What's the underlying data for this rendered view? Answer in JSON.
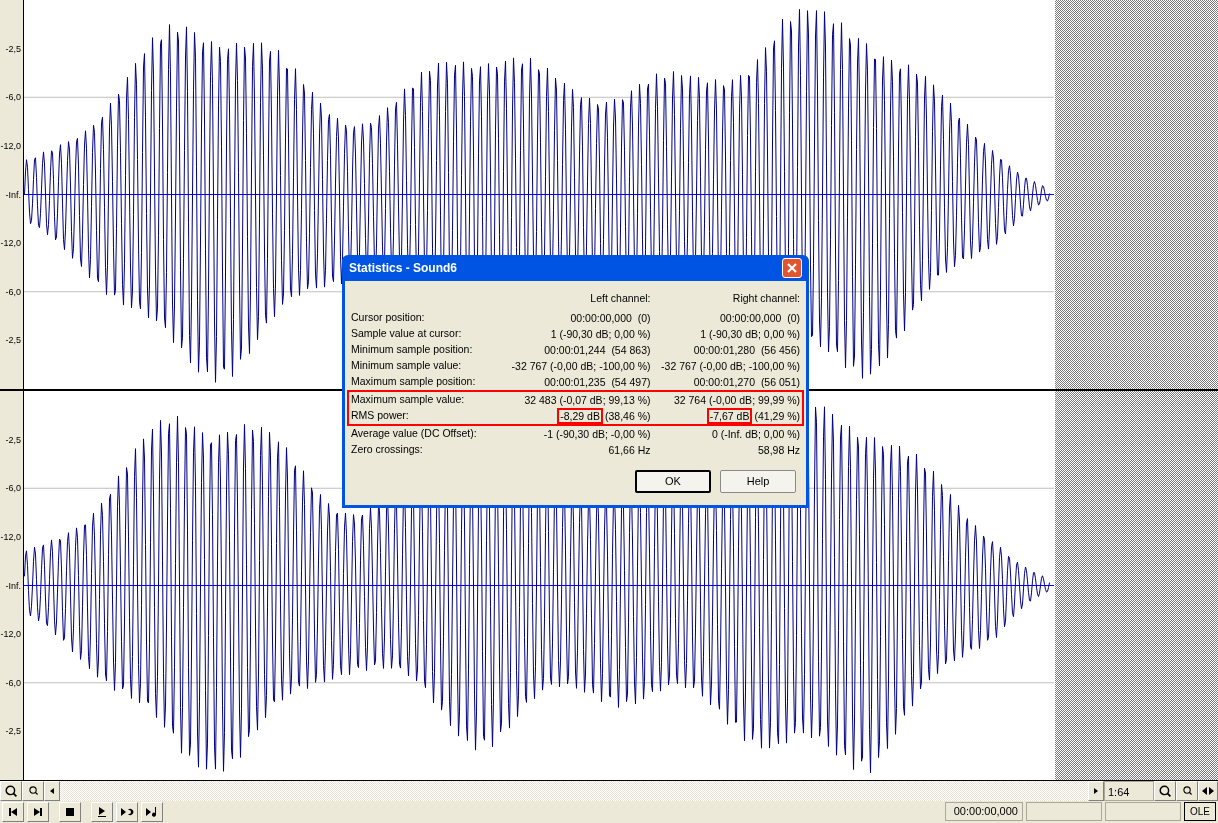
{
  "channels": [
    {
      "axis_labels": [
        "-2,5",
        "-6,0",
        "-12,0",
        "-Inf.",
        "-12,0",
        "-6,0",
        "-2,5"
      ]
    },
    {
      "axis_labels": [
        "-2,5",
        "-6,0",
        "-12,0",
        "-Inf.",
        "-12,0",
        "-6,0",
        "-2,5"
      ]
    }
  ],
  "dialog": {
    "title": "Statistics - Sound6",
    "columns": [
      "Left channel:",
      "Right channel:"
    ],
    "rows": [
      {
        "label": "Cursor position:",
        "highlighted": false,
        "left": [
          {
            "text": "00:00:00,000  (0)",
            "boxed": false
          }
        ],
        "right": [
          {
            "text": "00:00:00,000  (0)",
            "boxed": false
          }
        ]
      },
      {
        "label": "Sample value at cursor:",
        "highlighted": false,
        "left": [
          {
            "text": "1 (-90,30 dB; 0,00 %)",
            "boxed": false
          }
        ],
        "right": [
          {
            "text": "1 (-90,30 dB; 0,00 %)",
            "boxed": false
          }
        ]
      },
      {
        "label": "Minimum sample position:",
        "highlighted": false,
        "left": [
          {
            "text": "00:00:01,244  (54 863)",
            "boxed": false
          }
        ],
        "right": [
          {
            "text": "00:00:01,280  (56 456)",
            "boxed": false
          }
        ]
      },
      {
        "label": "Minimum sample value:",
        "highlighted": false,
        "left": [
          {
            "text": "-32 767 (-0,00 dB; -100,00 %)",
            "boxed": false
          }
        ],
        "right": [
          {
            "text": "-32 767 (-0,00 dB; -100,00 %)",
            "boxed": false
          }
        ]
      },
      {
        "label": "Maximum sample position:",
        "highlighted": false,
        "left": [
          {
            "text": "00:00:01,235  (54 497)",
            "boxed": false
          }
        ],
        "right": [
          {
            "text": "00:00:01,270  (56 051)",
            "boxed": false
          }
        ]
      },
      {
        "label": "Maximum sample value:",
        "highlighted": true,
        "left": [
          {
            "text": "32 483 (-0,07 dB; 99,13 %)",
            "boxed": false
          }
        ],
        "right": [
          {
            "text": "32 764 (-0,00 dB; 99,99 %)",
            "boxed": false
          }
        ]
      },
      {
        "label": "RMS power:",
        "highlighted": true,
        "left": [
          {
            "text": "-8,29 dB",
            "boxed": true
          },
          {
            "text": "(38,46 %)",
            "boxed": false
          }
        ],
        "right": [
          {
            "text": "-7,67 dB",
            "boxed": true
          },
          {
            "text": "(41,29 %)",
            "boxed": false
          }
        ]
      },
      {
        "label": "Average value (DC Offset):",
        "highlighted": false,
        "left": [
          {
            "text": "-1 (-90,30 dB; -0,00 %)",
            "boxed": false
          }
        ],
        "right": [
          {
            "text": "0 (-Inf. dB; 0,00 %)",
            "boxed": false
          }
        ]
      },
      {
        "label": "Zero crossings:",
        "highlighted": false,
        "left": [
          {
            "text": "61,66 Hz",
            "boxed": false
          }
        ],
        "right": [
          {
            "text": "58,98 Hz",
            "boxed": false
          }
        ]
      }
    ],
    "buttons": [
      {
        "label": "OK",
        "default": true
      },
      {
        "label": "Help",
        "default": false
      }
    ]
  },
  "zoom_ratio": "1:64",
  "status_bar": {
    "time": "00:00:00,000",
    "indicator": "OLE"
  }
}
